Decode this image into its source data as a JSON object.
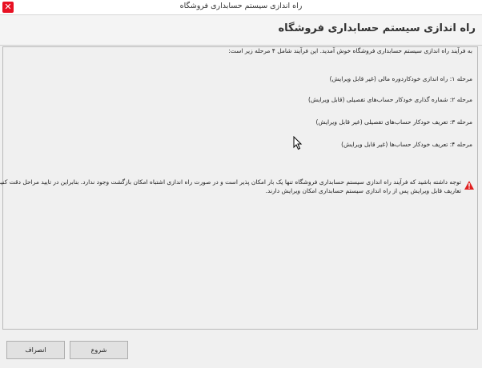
{
  "window": {
    "title": "راه اندازی سیستم حسابداری فروشگاه",
    "close_glyph": "✕"
  },
  "header": {
    "title": "راه اندازی سیستم حسابداری فروشگاه"
  },
  "content": {
    "intro": "به فرآیند راه اندازی سیستم حسابداری فروشگاه خوش آمدید. این فرآیند شامل ۴ مرحله زیر است:",
    "steps": [
      "مرحله ۱: راه اندازی خودکاردوره مالی (غیر قابل ویرایش)",
      "مرحله ۲: شماره گذاری خودکار حساب‌های تفصیلی (قابل ویرایش)",
      "مرحله ۳: تعریف خودکار حساب‌های تفصیلی (غیر قابل ویرایش)",
      "مرحله ۴: تعریف خودکار حساب‌ها (غیر قابل ویرایش)"
    ],
    "warning": {
      "line1": "توجه داشته باشید که فرآیند راه اندازی سیستم حسابداری فروشگاه تنها یک بار امکان پذیر است و در صورت راه اندازی اشتباه امکان بازگشت وجود ندارد. بنابراین در تایید مراحل دقت کنید.",
      "line2": "تعاریف قابل ویرایش پس از راه اندازی سیستم حسابداری امکان ویرایش دارند.",
      "icon": "warning-triangle",
      "icon_color": "#e02020"
    }
  },
  "footer": {
    "start_label": "شروع",
    "cancel_label": "انصراف"
  }
}
